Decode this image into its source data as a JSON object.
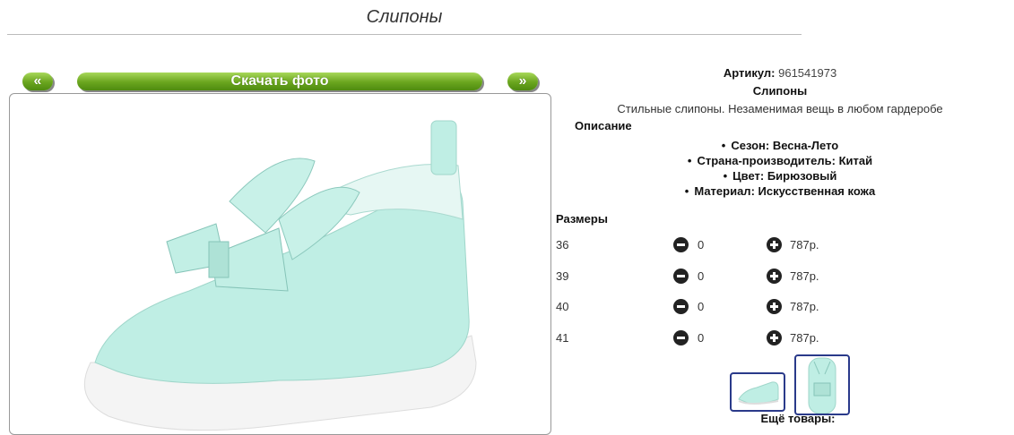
{
  "page": {
    "title": "Слипоны"
  },
  "gallery": {
    "prev_label": "«",
    "next_label": "»",
    "download_label": "Скачать фото"
  },
  "product": {
    "article_label": "Артикул:",
    "article_value": "961541973",
    "name": "Слипоны",
    "short_description": "Стильные слипоны. Незаменимая вещь в любом гардеробе",
    "description_heading": "Описание",
    "properties": [
      "Сезон: Весна-Лето",
      "Страна-производитель: Китай",
      "Цвет: Бирюзовый",
      "Материал: Искусственная кожа"
    ]
  },
  "sizes": {
    "heading": "Размеры",
    "rows": [
      {
        "size": "36",
        "qty": "0",
        "price": "787р."
      },
      {
        "size": "39",
        "qty": "0",
        "price": "787р."
      },
      {
        "size": "40",
        "qty": "0",
        "price": "787р."
      },
      {
        "size": "41",
        "qty": "0",
        "price": "787р."
      }
    ]
  },
  "more_label": "Ещё товары:",
  "colors": {
    "shoe": "#bfeee4",
    "accent_green": "#6aa51e",
    "thumb_border": "#2a3a8a"
  }
}
